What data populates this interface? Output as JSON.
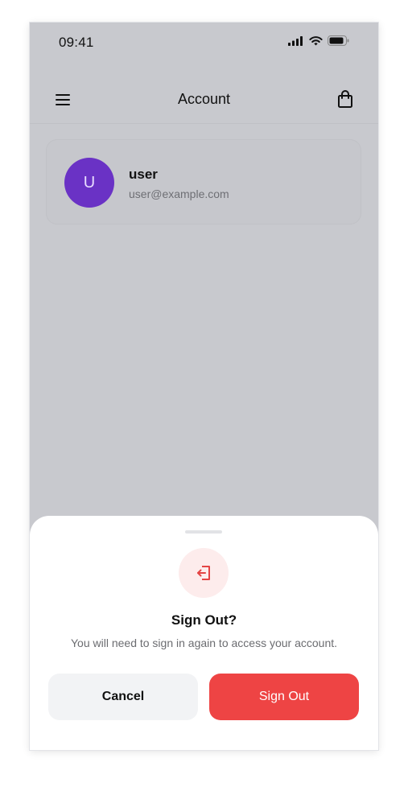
{
  "status_bar": {
    "time": "09:41",
    "icons": [
      "cellular-signal-icon",
      "wifi-icon",
      "battery-icon"
    ]
  },
  "header": {
    "title": "Account",
    "left_icon": "hamburger-menu-icon",
    "right_icon": "shopping-bag-icon"
  },
  "profile": {
    "avatar_initial": "U",
    "name": "user",
    "email": "user@example.com",
    "avatar_color": "#6a32c5"
  },
  "sign_out_sheet": {
    "icon": "sign-out-icon",
    "title": "Sign Out?",
    "description": "You will need to sign in again to access your account.",
    "cancel_label": "Cancel",
    "confirm_label": "Sign Out",
    "confirm_color": "#ee4444"
  }
}
